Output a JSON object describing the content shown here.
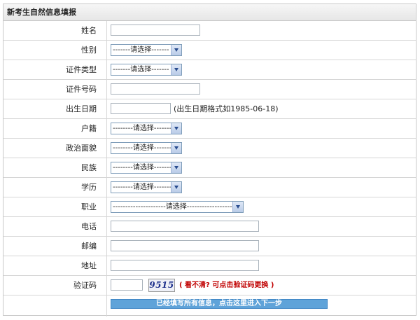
{
  "header": {
    "title": "新考生自然信息填报"
  },
  "fields": {
    "name": {
      "label": "姓名",
      "value": ""
    },
    "gender": {
      "label": "性别",
      "selected": "-------请选择-------"
    },
    "id_type": {
      "label": "证件类型",
      "selected": "-------请选择-------"
    },
    "id_number": {
      "label": "证件号码",
      "value": ""
    },
    "birth_date": {
      "label": "出生日期",
      "value": "",
      "hint": "(出生日期格式如1985-06-18)"
    },
    "household": {
      "label": "户籍",
      "selected": "--------请选择-------"
    },
    "political": {
      "label": "政治面貌",
      "selected": "--------请选择-------"
    },
    "ethnicity": {
      "label": "民族",
      "selected": "--------请选择-------"
    },
    "education": {
      "label": "学历",
      "selected": "--------请选择-------"
    },
    "occupation": {
      "label": "职业",
      "selected": "---------------------请选择--------------------"
    },
    "phone": {
      "label": "电话",
      "value": ""
    },
    "postcode": {
      "label": "邮编",
      "value": ""
    },
    "address": {
      "label": "地址",
      "value": ""
    },
    "captcha": {
      "label": "验证码",
      "value": "",
      "image_text": "9515",
      "hint": "( 看不清? 可点击验证码更换 )"
    }
  },
  "submit": {
    "label": "已经填写所有信息，点击这里进入下一步"
  },
  "colors": {
    "header_bg": "#e6e6e6",
    "button_bg": "#5fa3d9",
    "hint_red": "#c00000",
    "border": "#d6d6d6"
  }
}
